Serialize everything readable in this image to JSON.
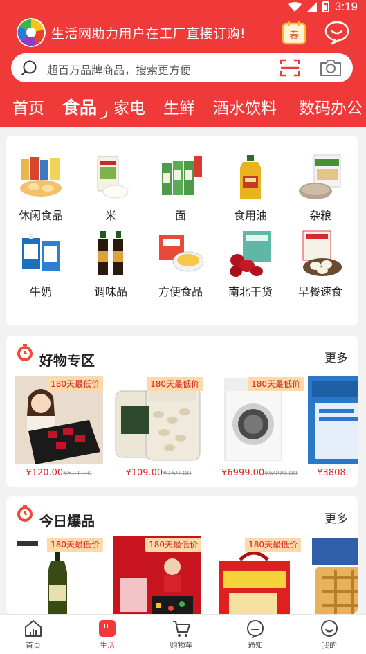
{
  "status": {
    "time": "3:19"
  },
  "header": {
    "slogan": "生活网助力用户在工厂直接订购!",
    "calendar_badge": "春"
  },
  "search": {
    "placeholder": "超百万品牌商品，搜索更方便"
  },
  "tabs": [
    {
      "label": "首页"
    },
    {
      "label": "食品"
    },
    {
      "label": "家电"
    },
    {
      "label": "生鲜"
    },
    {
      "label": "酒水饮料"
    },
    {
      "label": "数码办公"
    }
  ],
  "categories": [
    {
      "label": "休闲食品"
    },
    {
      "label": "米"
    },
    {
      "label": "面"
    },
    {
      "label": "食用油"
    },
    {
      "label": "杂粮"
    },
    {
      "label": "牛奶"
    },
    {
      "label": "调味品"
    },
    {
      "label": "方便食品"
    },
    {
      "label": "南北干货"
    },
    {
      "label": "早餐速食"
    }
  ],
  "section1": {
    "title": "好物专区",
    "more": "更多",
    "products": [
      {
        "tag": "180天最低价",
        "price": "¥120.00",
        "old_price": "¥521.00"
      },
      {
        "tag": "180天最低价",
        "price": "¥109.00",
        "old_price": "¥159.00"
      },
      {
        "tag": "180天最低价",
        "price": "¥6999.00",
        "old_price": "¥6999.00"
      },
      {
        "tag": "",
        "price": "¥3808.",
        "old_price": ""
      }
    ]
  },
  "section2": {
    "title": "今日爆品",
    "more": "更多",
    "products": [
      {
        "tag": "180天最低价"
      },
      {
        "tag": "180天最低价"
      },
      {
        "tag": "180天最低价"
      },
      {
        "tag": ""
      }
    ]
  },
  "bottom_nav": [
    {
      "label": "首页",
      "icon": "home-icon"
    },
    {
      "label": "生活",
      "icon": "life-icon"
    },
    {
      "label": "购物车",
      "icon": "cart-icon"
    },
    {
      "label": "通知",
      "icon": "notice-icon"
    },
    {
      "label": "我的",
      "icon": "profile-icon"
    }
  ],
  "colors": {
    "brand": "#f03a3a",
    "price": "#e02424",
    "tag_bg": "#ffd9a8"
  }
}
